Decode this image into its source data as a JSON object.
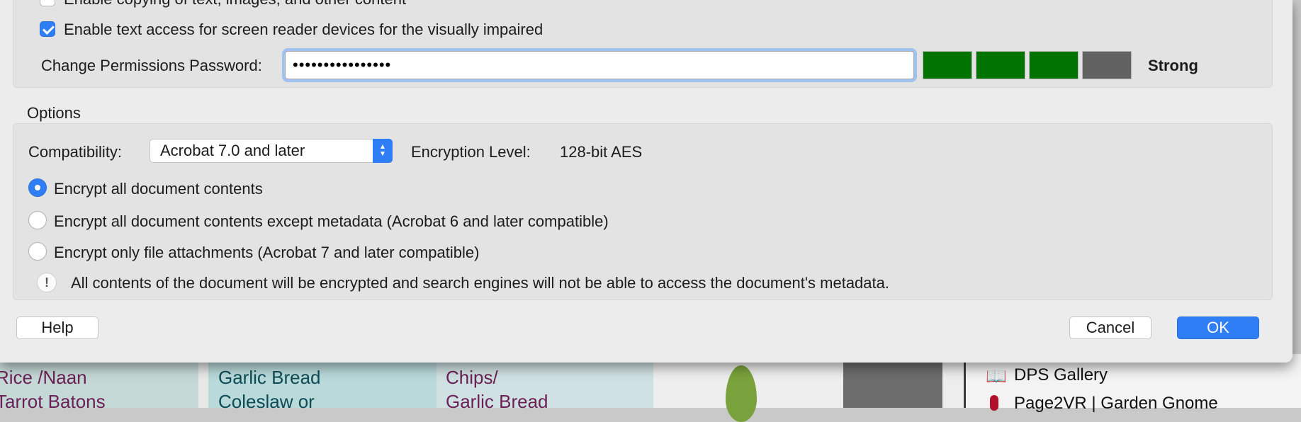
{
  "security": {
    "copy_label": "Enable copying of text, images, and other content",
    "screen_reader_label": "Enable text access for screen reader devices for the visually impaired",
    "perm_password_label": "Change Permissions Password:",
    "perm_password_value": "••••••••••••••••",
    "strength_label": "Strong",
    "strength_level": "3 of 4",
    "strength_colors": {
      "filled": "#007300",
      "empty": "#616161"
    }
  },
  "options": {
    "section_title": "Options",
    "compat_label": "Compatibility:",
    "compat_value": "Acrobat 7.0 and later",
    "encryption_label": "Encryption  Level:",
    "encryption_value": "128-bit AES",
    "radio_all": "Encrypt all document contents",
    "radio_except_meta": "Encrypt all document contents except metadata (Acrobat 6 and later compatible)",
    "radio_attachments": "Encrypt only file attachments (Acrobat 7 and later compatible)",
    "info_icon": "!",
    "info_text": "All contents of the document will be encrypted and search engines will not be able to access the document's metadata."
  },
  "buttons": {
    "help": "Help",
    "cancel": "Cancel",
    "ok": "OK"
  },
  "background": {
    "col1_line1": "Rice /Naan",
    "col1_line2": "Tarrot Batons",
    "col2_line1": "Garlic Bread",
    "col2_line2": "Coleslaw or",
    "col3_line1": "Chips/",
    "col3_line2": "Garlic Bread",
    "sidebar_item1": "DPS Gallery",
    "sidebar_item2": "Page2VR | Garden Gnome"
  },
  "colors": {
    "accent": "#2f7ef6",
    "menu_text": "#6b1f55",
    "teal_text": "#0d4c55"
  }
}
